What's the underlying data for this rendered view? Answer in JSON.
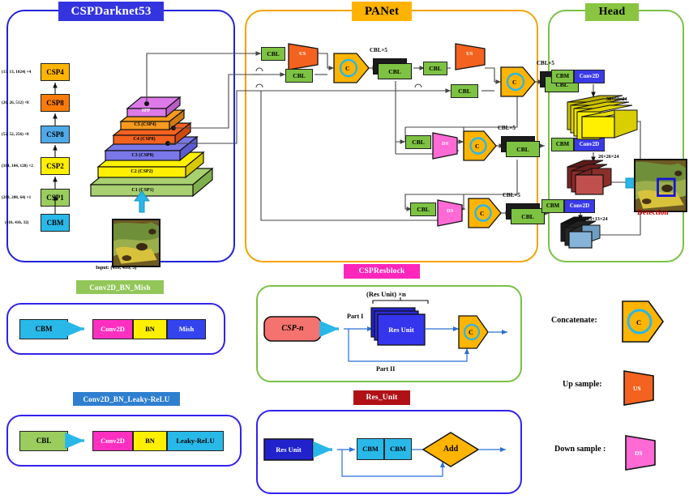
{
  "groups": {
    "backbone": {
      "title": "CSPDarknet53"
    },
    "neck": {
      "title": "PANet"
    },
    "head": {
      "title": "Head"
    },
    "cbm_legend": {
      "title": "Conv2D_BN_Mish"
    },
    "cbl_legend": {
      "title": "Conv2D_BN_Leaky-ReLU"
    },
    "cspresblock": {
      "title": "CSPResblock"
    },
    "resunit": {
      "title": "Res_Unit"
    }
  },
  "backbone": {
    "column": [
      {
        "label": "CSP4",
        "dims": "(13, 13, 1024) ×4"
      },
      {
        "label": "CSP8",
        "dims": "(26, 26, 512) ×8"
      },
      {
        "label": "CSP8",
        "dims": "(52, 52, 256) ×8"
      },
      {
        "label": "CSP2",
        "dims": "(104, 104, 128) ×2"
      },
      {
        "label": "CSP1",
        "dims": "(208, 208, 64) ×1"
      },
      {
        "label": "CBM",
        "dims": "(416, 416, 32)"
      }
    ],
    "pyramid": [
      {
        "label": "C1 (CSP1)"
      },
      {
        "label": "C2 (CSP2)"
      },
      {
        "label": "C3 (CSP8)"
      },
      {
        "label": "C4 (CSP8)"
      },
      {
        "label": "C5 (CSP4)"
      },
      {
        "label": "SPP"
      }
    ],
    "input_caption": "Input: (416, 416, 3)"
  },
  "neck": {
    "cbl": "CBL",
    "us": "US",
    "ds": "DS",
    "concat": "C",
    "cbl5": "CBL×5"
  },
  "head": {
    "cbm": "CBM",
    "conv2d": "Conv2D",
    "maps": [
      {
        "size": "52×52×24"
      },
      {
        "size": "26×26×24"
      },
      {
        "size": "13×13×24"
      }
    ],
    "detection_caption": "Detection"
  },
  "legend_cbm": {
    "source": "CBM",
    "parts": [
      "Conv2D",
      "BN",
      "Mish"
    ]
  },
  "legend_cbl": {
    "source": "CBL",
    "parts": [
      "Conv2D",
      "BN",
      "Leaky-ReLU"
    ]
  },
  "cspresblock": {
    "source": "CSP-n",
    "part1": "Part I",
    "part2": "Part II",
    "resunit": "Res Unit",
    "repeat": "(Res Unit) ×n",
    "concat": "C"
  },
  "resunit": {
    "source": "Res Unit",
    "cbm": "CBM",
    "add": "Add"
  },
  "legend": {
    "items": [
      {
        "label": "Concatenate:",
        "glyph": "C"
      },
      {
        "label": "Up sample:",
        "glyph": "US"
      },
      {
        "label": "Down sample :",
        "glyph": "DS"
      }
    ]
  },
  "colors": {
    "backbone_border": "#2222dd",
    "neck_border": "#f5a300",
    "head_border": "#7ac143",
    "cbl": "#7dc242",
    "cbm": "#28b9e8",
    "concat": "#ffb400",
    "upsample": "#f97b0a",
    "downsample": "#ff2fc0",
    "detection_text": "#c00000"
  }
}
